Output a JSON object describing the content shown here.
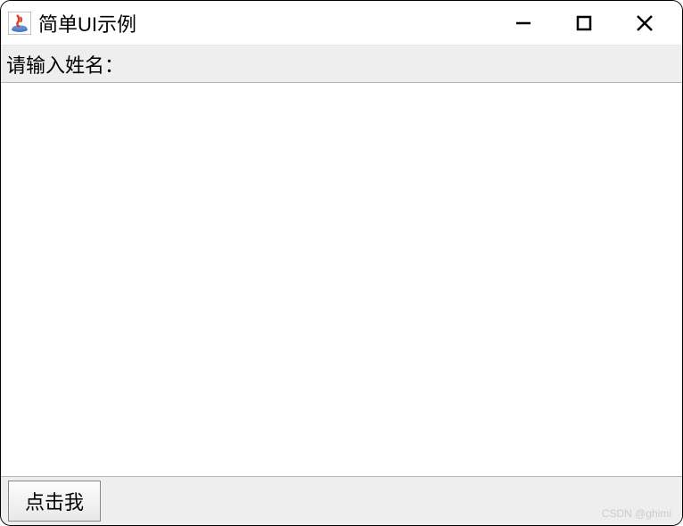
{
  "window": {
    "title": "简单UI示例"
  },
  "form": {
    "name_label": "请输入姓名：",
    "button_label": "点击我"
  },
  "watermark": "CSDN @ghimi"
}
